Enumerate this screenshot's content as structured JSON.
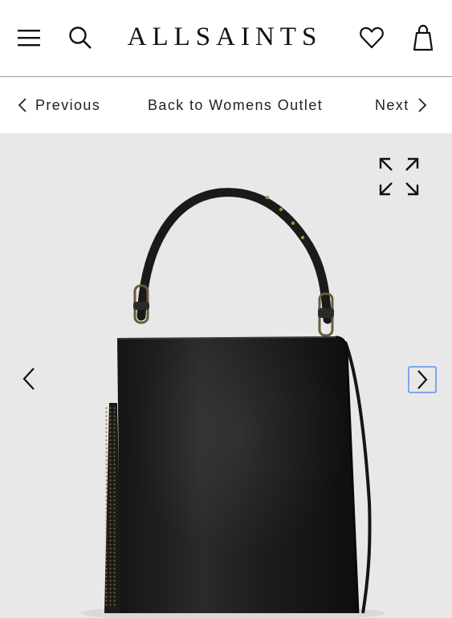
{
  "header": {
    "logo_text": "ALLSAINTS",
    "icons": [
      "menu-icon",
      "search-icon",
      "heart-icon",
      "shopping-bag-icon"
    ]
  },
  "nav": {
    "previous_label": "Previous",
    "back_label": "Back to Womens Outlet",
    "next_label": "Next"
  },
  "gallery": {
    "icons": [
      "expand-icon",
      "chevron-left-icon",
      "chevron-right-icon"
    ],
    "background_color": "#e8e8e8",
    "focus_ring_color": "#7aa7e6"
  }
}
